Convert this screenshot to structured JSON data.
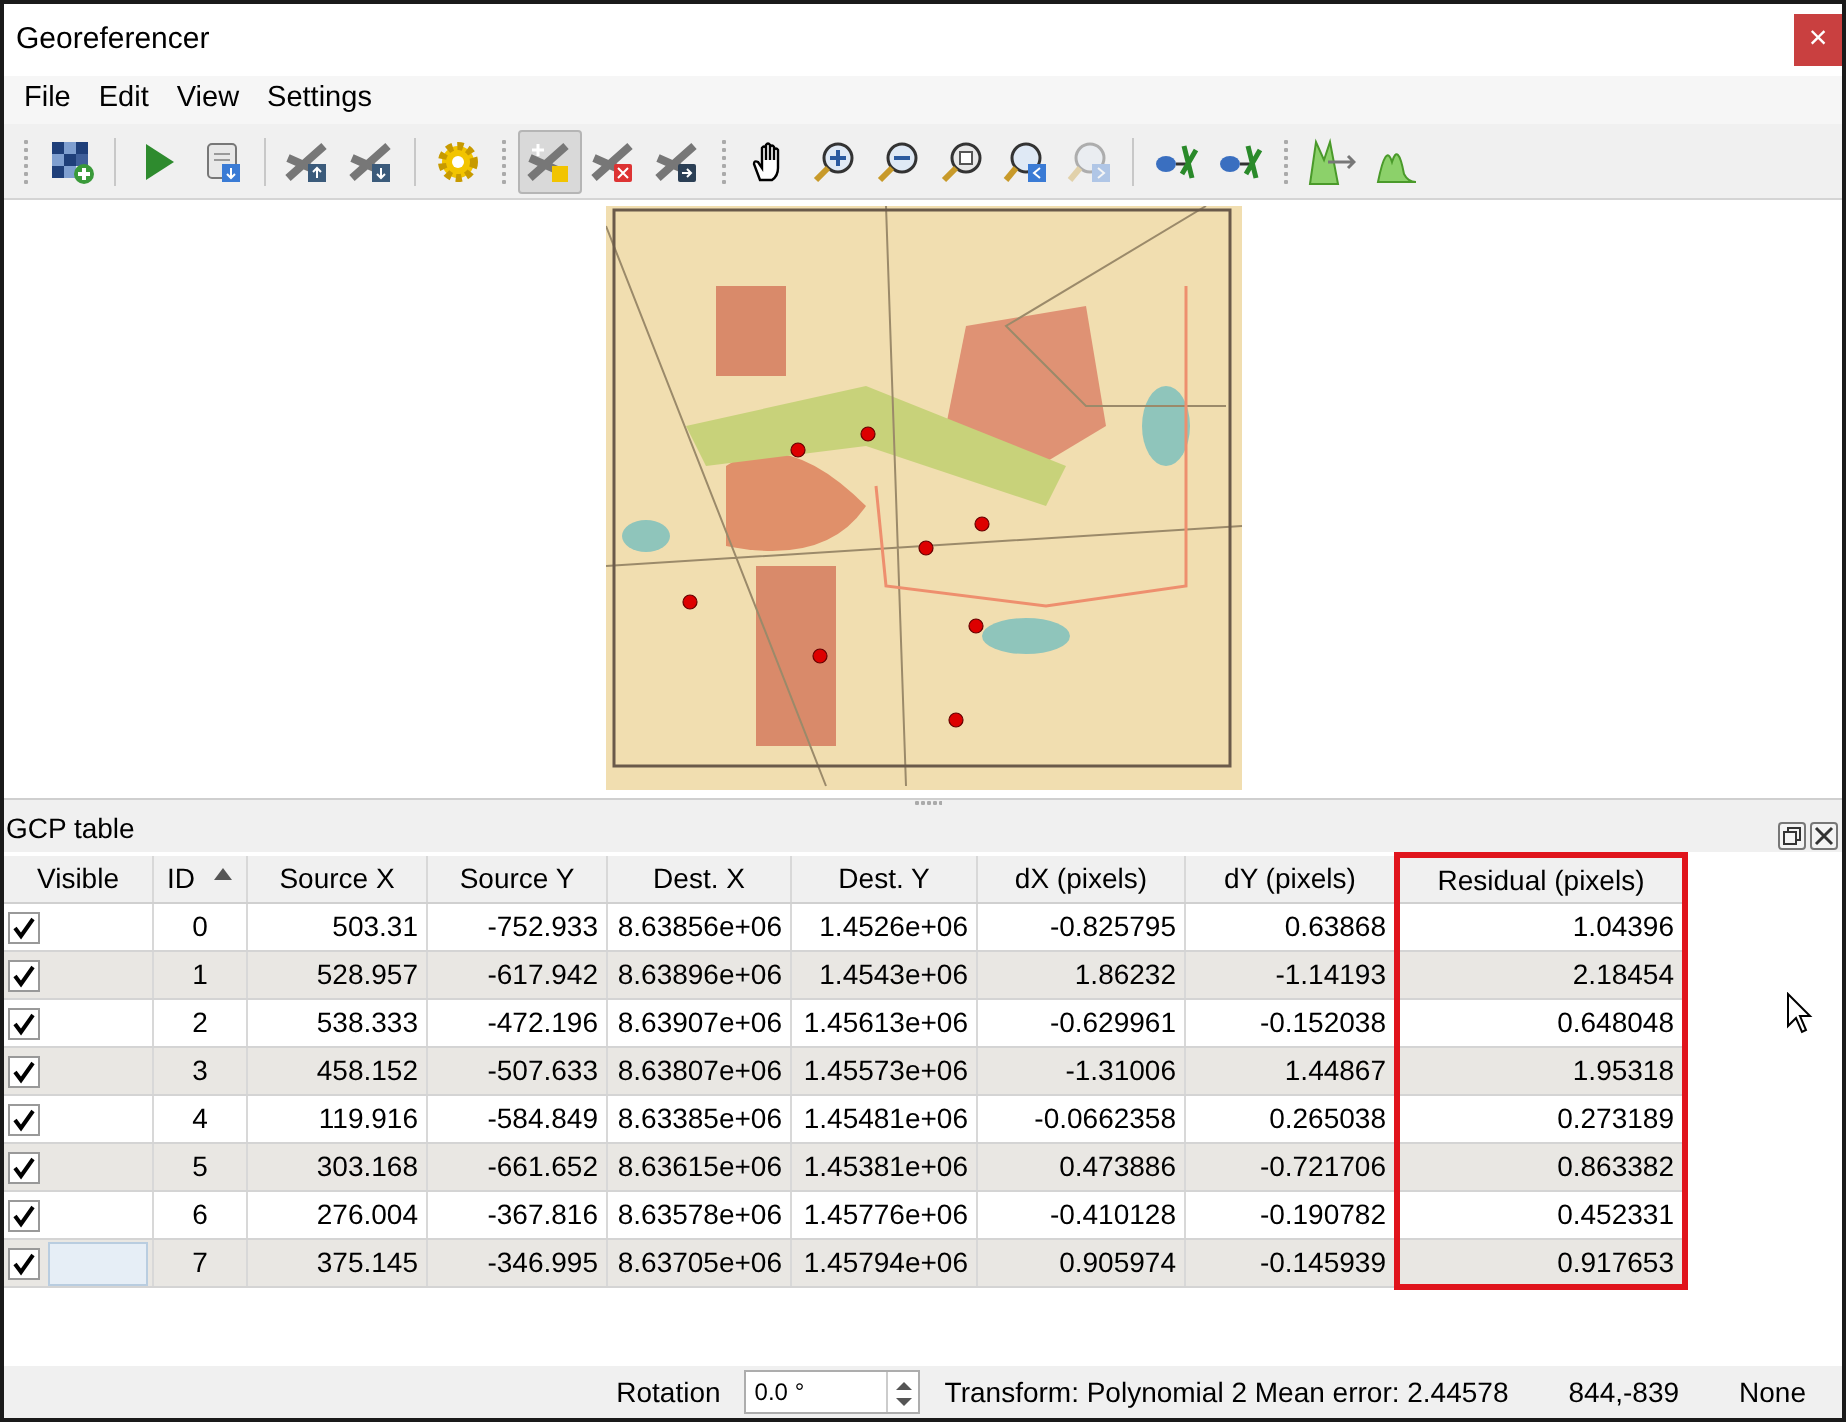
{
  "window": {
    "title": "Georeferencer",
    "close_glyph": "×"
  },
  "menu": [
    "File",
    "Edit",
    "View",
    "Settings"
  ],
  "toolbar_groups": [
    {
      "tools": [
        {
          "selected": false,
          "disabled": false
        }
      ]
    },
    {
      "tools": [
        {
          "selected": false,
          "disabled": false
        },
        {
          "selected": false,
          "disabled": false
        }
      ]
    },
    {
      "tools": [
        {
          "selected": false,
          "disabled": false
        },
        {
          "selected": false,
          "disabled": false
        }
      ]
    },
    {
      "tools": [
        {
          "selected": false,
          "disabled": false
        }
      ]
    },
    {
      "tools": [
        {
          "selected": true,
          "disabled": false
        },
        {
          "selected": false,
          "disabled": false
        },
        {
          "selected": false,
          "disabled": false
        }
      ]
    },
    {
      "tools": [
        {
          "selected": false,
          "disabled": false
        },
        {
          "selected": false,
          "disabled": false
        },
        {
          "selected": false,
          "disabled": false
        },
        {
          "selected": false,
          "disabled": false
        },
        {
          "selected": false,
          "disabled": false
        },
        {
          "selected": false,
          "disabled": true
        }
      ]
    },
    {
      "tools": [
        {
          "selected": false,
          "disabled": false
        },
        {
          "selected": false,
          "disabled": false
        }
      ]
    },
    {
      "tools": [
        {
          "selected": false,
          "disabled": false
        },
        {
          "selected": false,
          "disabled": false
        }
      ]
    }
  ],
  "gcp_table": {
    "title": "GCP table",
    "columns": [
      {
        "label": "Visible",
        "highlighted": false,
        "sorted": false
      },
      {
        "label": "ID",
        "highlighted": false,
        "sorted": true
      },
      {
        "label": "Source X",
        "highlighted": false,
        "sorted": false
      },
      {
        "label": "Source Y",
        "highlighted": false,
        "sorted": false
      },
      {
        "label": "Dest. X",
        "highlighted": false,
        "sorted": false
      },
      {
        "label": "Dest. Y",
        "highlighted": false,
        "sorted": false
      },
      {
        "label": "dX (pixels)",
        "highlighted": false,
        "sorted": false
      },
      {
        "label": "dY (pixels)",
        "highlighted": false,
        "sorted": false
      },
      {
        "label": "Residual (pixels)",
        "highlighted": true,
        "sorted": false
      }
    ],
    "rows": [
      {
        "visible": true,
        "focused": false,
        "cells": [
          "",
          "0",
          "503.31",
          "-752.933",
          "8.63856e+06",
          "1.4526e+06",
          "-0.825795",
          "0.63868",
          "1.04396"
        ]
      },
      {
        "visible": true,
        "focused": false,
        "cells": [
          "",
          "1",
          "528.957",
          "-617.942",
          "8.63896e+06",
          "1.4543e+06",
          "1.86232",
          "-1.14193",
          "2.18454"
        ]
      },
      {
        "visible": true,
        "focused": false,
        "cells": [
          "",
          "2",
          "538.333",
          "-472.196",
          "8.63907e+06",
          "1.45613e+06",
          "-0.629961",
          "-0.152038",
          "0.648048"
        ]
      },
      {
        "visible": true,
        "focused": false,
        "cells": [
          "",
          "3",
          "458.152",
          "-507.633",
          "8.63807e+06",
          "1.45573e+06",
          "-1.31006",
          "1.44867",
          "1.95318"
        ]
      },
      {
        "visible": true,
        "focused": false,
        "cells": [
          "",
          "4",
          "119.916",
          "-584.849",
          "8.63385e+06",
          "1.45481e+06",
          "-0.0662358",
          "0.265038",
          "0.273189"
        ]
      },
      {
        "visible": true,
        "focused": false,
        "cells": [
          "",
          "5",
          "303.168",
          "-661.652",
          "8.63615e+06",
          "1.45381e+06",
          "0.473886",
          "-0.721706",
          "0.863382"
        ]
      },
      {
        "visible": true,
        "focused": false,
        "cells": [
          "",
          "6",
          "276.004",
          "-367.816",
          "8.63578e+06",
          "1.45776e+06",
          "-0.410128",
          "-0.190782",
          "0.452331"
        ]
      },
      {
        "visible": true,
        "focused": true,
        "cells": [
          "",
          "7",
          "375.145",
          "-346.995",
          "8.63705e+06",
          "1.45794e+06",
          "0.905974",
          "-0.145939",
          "0.917653"
        ]
      }
    ]
  },
  "status_bar": {
    "rotation_label": "Rotation",
    "rotation_value": "0.0 °",
    "transform": "Transform: Polynomial 2 Mean error: 2.44578",
    "coordinates": "844,-839",
    "crs": "None"
  }
}
